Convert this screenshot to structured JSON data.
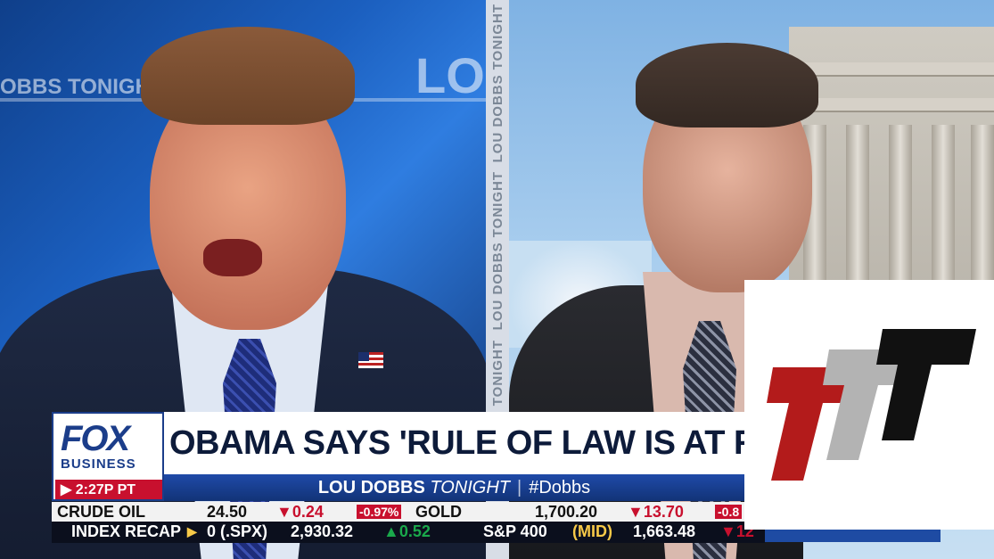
{
  "left_panel": {
    "background_brand_text": "OBBS TONIGHT",
    "background_logo_text": "LOU"
  },
  "divider_text": [
    "LOU DOBBS TONIGHT",
    "LOU DOBBS TONIGHT",
    "DOBBS TONIGHT"
  ],
  "lower_third": {
    "logo_main": "FOX",
    "logo_sub": "BUSINESS",
    "time": "▶ 2:27P PT",
    "headline": "OBAMA SAYS 'RULE OF LAW IS AT RISK",
    "show_name_bold": "LOU DOBBS",
    "show_name_italic": "TONIGHT",
    "hashtag": "#Dobbs"
  },
  "ticker": {
    "row1": {
      "crude_label": "CRUDE OIL",
      "crude_price": "24.50",
      "crude_change": "▼0.24",
      "crude_pct": "-0.97%",
      "gold_label": "GOLD",
      "gold_price": "1,700.20",
      "gold_change": "▼13.70",
      "gold_pct": "-0.8"
    },
    "row2": {
      "recap_label": "INDEX RECAP",
      "arrow": "▶",
      "spx_label": "0 (.SPX)",
      "spx_value": "2,930.32",
      "spx_change": "▲0.52",
      "mid_label": "S&P 400",
      "mid_tag": "(MID)",
      "mid_value": "1,663.48",
      "mid_change": "▼12"
    }
  },
  "colors": {
    "fox_blue": "#1b3d8a",
    "alert_red": "#c8102e",
    "logo_red": "#b31b1b",
    "logo_gray": "#b3b3b3",
    "logo_black": "#111111"
  },
  "watermark_icon": "ttt-logo"
}
